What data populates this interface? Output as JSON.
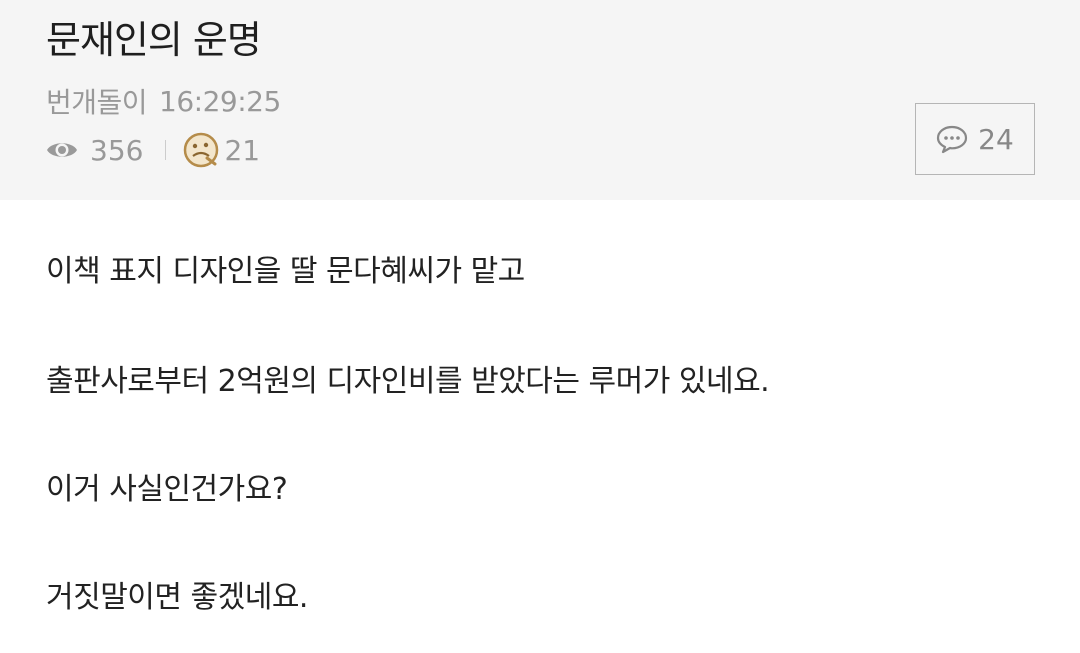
{
  "post": {
    "title": "문재인의 운명",
    "author": "번개돌이",
    "time": "16:29:25",
    "views": "356",
    "reactions": "21",
    "comments": "24"
  },
  "body": {
    "lines": [
      "이책 표지 디자인을 딸 문다혜씨가 맡고",
      "출판사로부터 2억원의 디자인비를 받았다는 루머가 있네요.",
      "이거 사실인건가요?",
      "거짓말이면 좋겠네요."
    ]
  },
  "icons": {
    "views": "eye-icon",
    "reactions": "reaction-face-icon",
    "comments": "speech-bubble-icon"
  },
  "colors": {
    "header_bg": "#f5f5f5",
    "meta_text": "#999999",
    "body_text": "#222222",
    "reaction_accent": "#b58c4a"
  }
}
